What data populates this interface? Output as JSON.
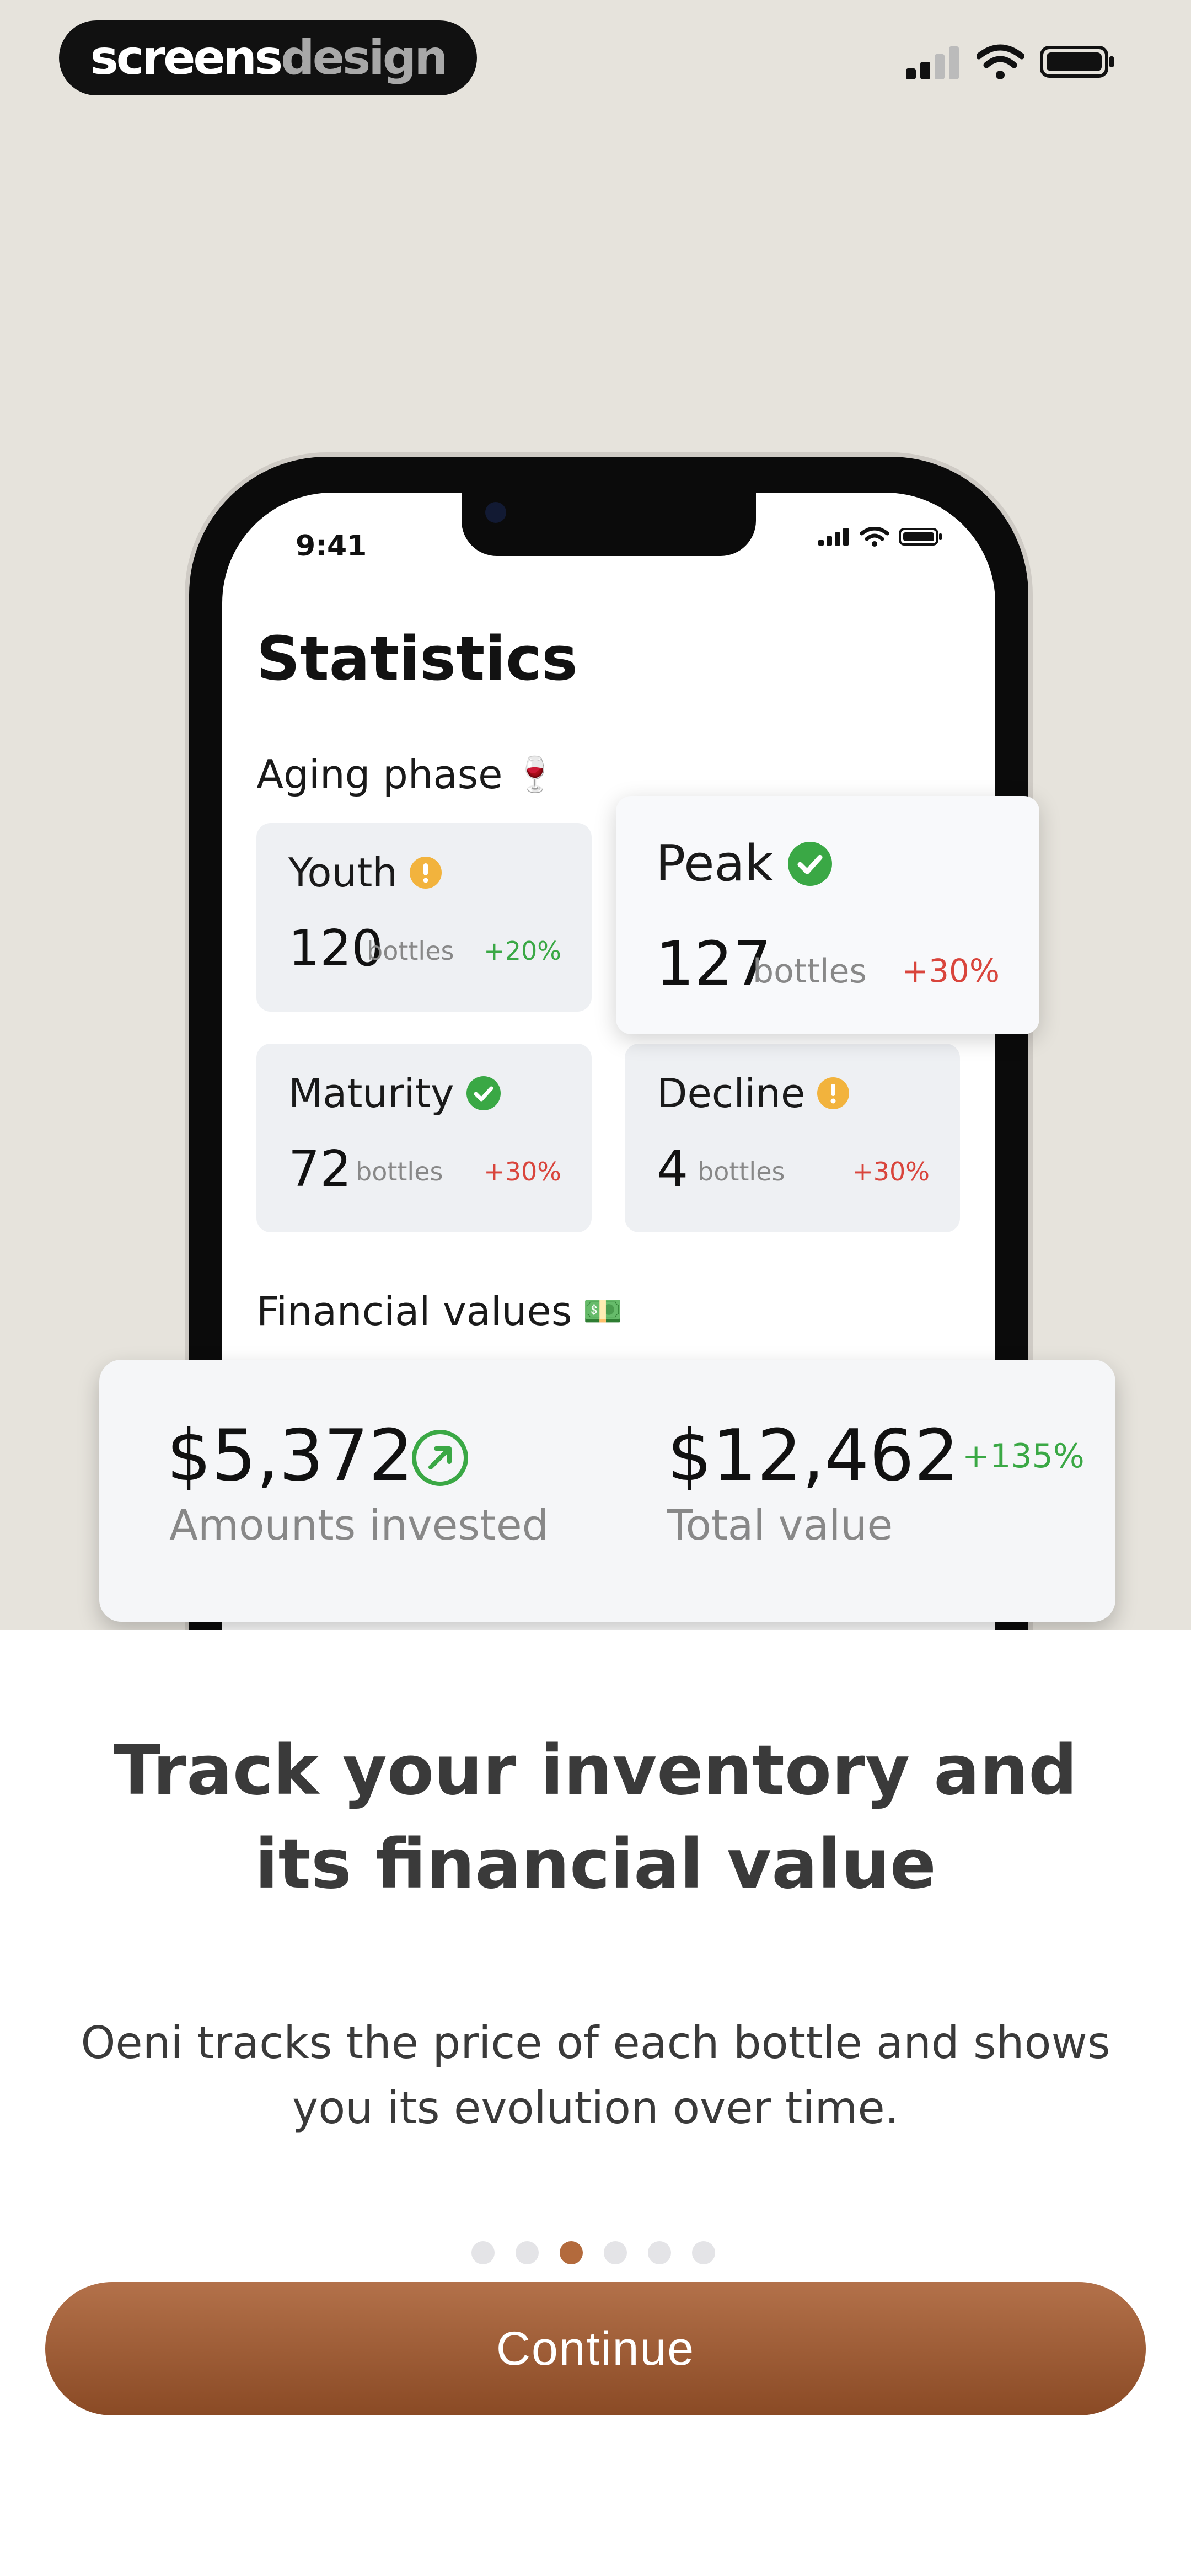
{
  "brand": {
    "part1": "screens",
    "part2": "design"
  },
  "mockup": {
    "time": "9:41",
    "title": "Statistics",
    "aging_section": "Aging phase",
    "aging_emoji": "🍷",
    "cards": [
      {
        "label": "Youth",
        "value": "120",
        "unit": "bottles",
        "change": "+20%"
      },
      {
        "label": "Peak",
        "value": "127",
        "unit": "bottles",
        "change": "+30%"
      },
      {
        "label": "Maturity",
        "value": "72",
        "unit": "bottles",
        "change": "+30%"
      },
      {
        "label": "Decline",
        "value": "4",
        "unit": "bottles",
        "change": "+30%"
      }
    ],
    "financial_section": "Financial values",
    "financial_emoji": "💵"
  },
  "financial": {
    "invested_value": "$5,372",
    "invested_label": "Amounts invested",
    "total_value": "$12,462",
    "total_label": "Total value",
    "total_change": "+135%"
  },
  "onboarding": {
    "headline": "Track your inventory and its financial value",
    "description": "Oeni tracks the price of each bottle and shows you its evolution over time.",
    "page_count": 6,
    "active_page": 3,
    "continue_label": "Continue"
  },
  "colors": {
    "accent": "#a05c34",
    "background": "#e6e3dc",
    "positive": "#3aa845",
    "negative": "#d9453c",
    "warning": "#f2b33d"
  }
}
